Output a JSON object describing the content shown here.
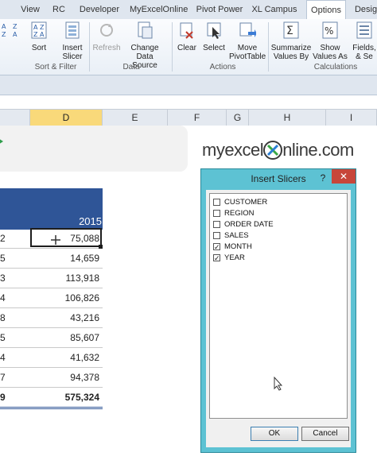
{
  "ribbon": {
    "tabs": [
      "View",
      "RC",
      "Developer",
      "MyExcelOnline",
      "Pivot Power",
      "XL Campus",
      "Options",
      "Desig"
    ],
    "active_tab": "Options",
    "buttons": {
      "sort": "Sort",
      "insert_slicer_1": "Insert",
      "insert_slicer_2": "Slicer",
      "refresh": "Refresh",
      "change_ds_1": "Change Data",
      "change_ds_2": "Source",
      "clear": "Clear",
      "select": "Select",
      "move_1": "Move",
      "move_2": "PivotTable",
      "summarize_1": "Summarize",
      "summarize_2": "Values By",
      "show_1": "Show",
      "show_2": "Values As",
      "fields_1": "Fields,",
      "fields_2": "& Se"
    },
    "groups": {
      "sort_filter": "Sort & Filter",
      "data": "Data",
      "actions": "Actions",
      "calculations": "Calculations"
    }
  },
  "columns": [
    "D",
    "E",
    "F",
    "G",
    "H",
    "I"
  ],
  "selected_column": "D",
  "logo": {
    "before": "myexcel",
    "after": "nline.com"
  },
  "table": {
    "year": "2015",
    "rows": [
      {
        "left": "2",
        "value": "75,088"
      },
      {
        "left": "5",
        "value": "14,659"
      },
      {
        "left": "3",
        "value": "113,918"
      },
      {
        "left": "4",
        "value": "106,826"
      },
      {
        "left": "8",
        "value": "43,216"
      },
      {
        "left": "5",
        "value": "85,607"
      },
      {
        "left": "4",
        "value": "41,632"
      },
      {
        "left": "7",
        "value": "94,378"
      }
    ],
    "total": {
      "left": "9",
      "value": "575,324"
    }
  },
  "dialog": {
    "title": "Insert Slicers",
    "help": "?",
    "close": "✕",
    "fields": [
      {
        "label": "CUSTOMER",
        "checked": false
      },
      {
        "label": "REGION",
        "checked": false
      },
      {
        "label": "ORDER DATE",
        "checked": false
      },
      {
        "label": "SALES",
        "checked": false
      },
      {
        "label": "MONTH",
        "checked": true
      },
      {
        "label": "YEAR",
        "checked": true
      }
    ],
    "ok": "OK",
    "cancel": "Cancel"
  },
  "colors": {
    "table_header": "#2f5597",
    "dialog_frame": "#5dc2d3",
    "close_button": "#c7463a",
    "selected_column": "#f9d97a"
  }
}
